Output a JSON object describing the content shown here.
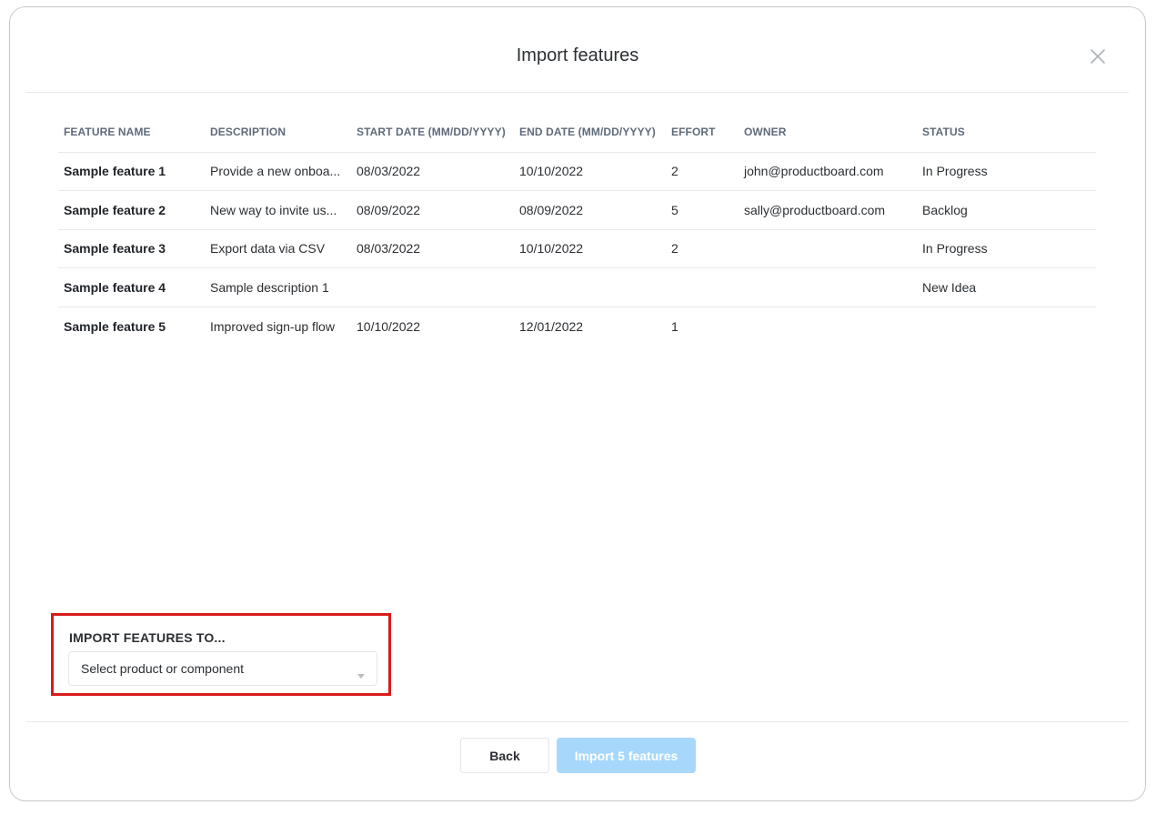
{
  "dialog": {
    "title": "Import features",
    "close_icon": "close-icon"
  },
  "table": {
    "columns": [
      "FEATURE NAME",
      "DESCRIPTION",
      "START DATE (MM/DD/YYYY)",
      "END DATE (MM/DD/YYYY)",
      "EFFORT",
      "OWNER",
      "STATUS"
    ],
    "rows": [
      {
        "name": "Sample feature 1",
        "description": "Provide a new onboa...",
        "start": "08/03/2022",
        "end": "10/10/2022",
        "effort": "2",
        "owner": "john@productboard.com",
        "status": "In Progress"
      },
      {
        "name": "Sample feature 2",
        "description": "New way to invite us...",
        "start": "08/09/2022",
        "end": "08/09/2022",
        "effort": "5",
        "owner": "sally@productboard.com",
        "status": "Backlog"
      },
      {
        "name": "Sample feature 3",
        "description": "Export data via CSV",
        "start": "08/03/2022",
        "end": "10/10/2022",
        "effort": "2",
        "owner": "",
        "status": "In Progress"
      },
      {
        "name": "Sample feature 4",
        "description": "Sample description 1",
        "start": "",
        "end": "",
        "effort": "",
        "owner": "",
        "status": "New Idea"
      },
      {
        "name": "Sample feature 5",
        "description": "Improved sign-up flow",
        "start": "10/10/2022",
        "end": "12/01/2022",
        "effort": "1",
        "owner": "",
        "status": ""
      }
    ]
  },
  "import_to": {
    "label": "IMPORT FEATURES TO...",
    "select_value": "Select product or component",
    "caret_icon": "chevron-down-icon",
    "highlight_color": "#d81b1b"
  },
  "footer": {
    "back_label": "Back",
    "import_label": "Import 5 features",
    "import_color": "#a7d8fb"
  }
}
